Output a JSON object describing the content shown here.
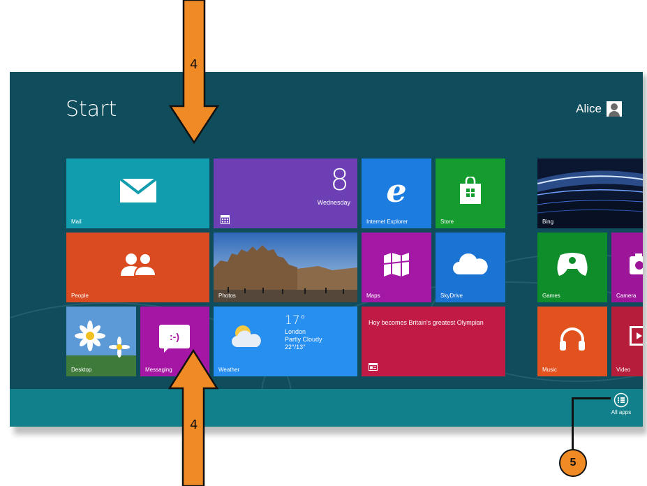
{
  "start": {
    "title": "Start"
  },
  "user": {
    "name": "Alice"
  },
  "tiles": {
    "mail": "Mail",
    "calendar_day": "8",
    "calendar_weekday": "Wednesday",
    "ie": "Internet Explorer",
    "store": "Store",
    "bing": "Bing",
    "people": "People",
    "photos": "Photos",
    "maps": "Maps",
    "skydrive": "SkyDrive",
    "games": "Games",
    "camera": "Camera",
    "desktop": "Desktop",
    "messaging": "Messaging",
    "messaging_face": ":-)",
    "weather": "Weather",
    "weather_temp": "17°",
    "weather_city": "London",
    "weather_cond": "Partly Cloudy",
    "weather_range": "22°/13°",
    "news_headline": "Hoy becomes Britain's greatest Olympian",
    "music": "Music",
    "video": "Video"
  },
  "appbar": {
    "all_apps": "All apps"
  },
  "annotations": {
    "arrow_top": "4",
    "arrow_bottom": "4",
    "callout": "5",
    "arrow_color": "#f08a24"
  },
  "colors": {
    "background": "#0f4c5c",
    "mail": "#119dae",
    "calendar": "#6c3fb4",
    "ie": "#1d7ce0",
    "store": "#149c2f",
    "people": "#da4b22",
    "maps": "#a319a6",
    "skydrive": "#1b74d4",
    "games": "#0f8d2a",
    "camera": "#9d1599",
    "messaging": "#a616a4",
    "weather": "#268ff0",
    "news": "#c01a45",
    "music": "#e1521e",
    "video": "#b51d3a"
  }
}
